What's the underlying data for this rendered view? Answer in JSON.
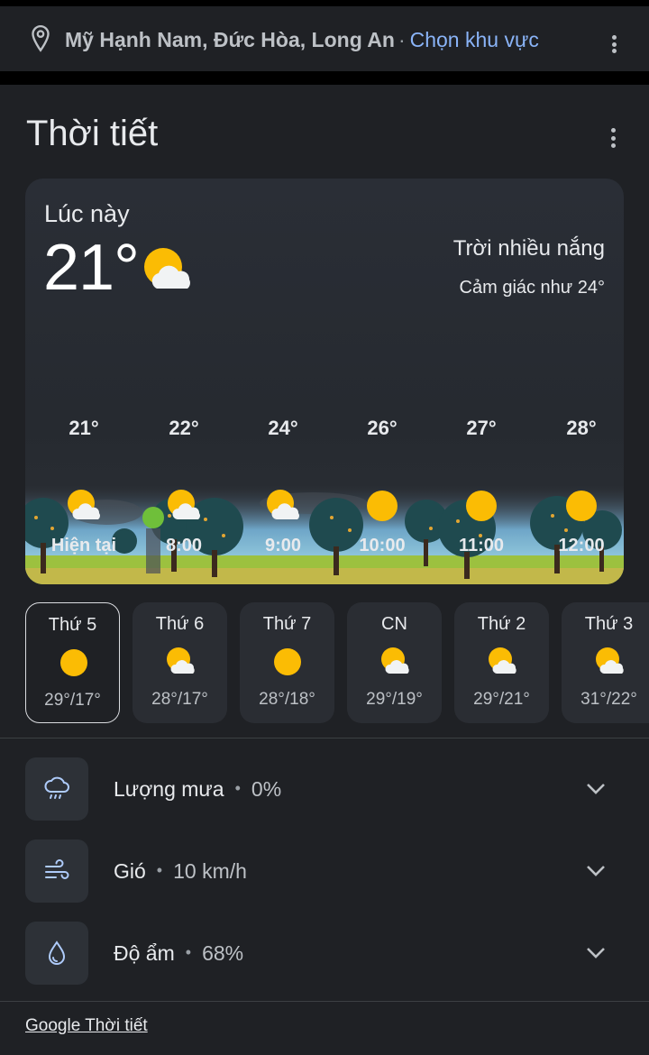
{
  "location": {
    "place": "Mỹ Hạnh Nam, Đức Hòa, Long An",
    "separator": "·",
    "change_link": "Chọn khu vực"
  },
  "card": {
    "title": "Thời tiết"
  },
  "current": {
    "label": "Lúc này",
    "temp": "21°",
    "condition": "Trời nhiều nắng",
    "feels_like": "Cảm giác như 24°",
    "icon": "partly-sunny-icon"
  },
  "hourly": [
    {
      "temp": "21°",
      "label": "Hiện tại",
      "icon": "partly-sunny-icon"
    },
    {
      "temp": "22°",
      "label": "8:00",
      "icon": "partly-sunny-icon"
    },
    {
      "temp": "24°",
      "label": "9:00",
      "icon": "partly-sunny-icon"
    },
    {
      "temp": "26°",
      "label": "10:00",
      "icon": "sunny-icon"
    },
    {
      "temp": "27°",
      "label": "11:00",
      "icon": "sunny-icon"
    },
    {
      "temp": "28°",
      "label": "12:00",
      "icon": "sunny-icon"
    }
  ],
  "daily": [
    {
      "day": "Thứ 5",
      "temps": "29°/17°",
      "icon": "sunny-icon",
      "selected": true
    },
    {
      "day": "Thứ 6",
      "temps": "28°/17°",
      "icon": "partly-sunny-icon",
      "selected": false
    },
    {
      "day": "Thứ 7",
      "temps": "28°/18°",
      "icon": "sunny-icon",
      "selected": false
    },
    {
      "day": "CN",
      "temps": "29°/19°",
      "icon": "partly-sunny-icon",
      "selected": false
    },
    {
      "day": "Thứ 2",
      "temps": "29°/21°",
      "icon": "partly-sunny-icon",
      "selected": false
    },
    {
      "day": "Thứ 3",
      "temps": "31°/22°",
      "icon": "partly-sunny-icon",
      "selected": false
    }
  ],
  "details": [
    {
      "label": "Lượng mưa",
      "value": "0%",
      "icon": "rain-icon"
    },
    {
      "label": "Gió",
      "value": "10 km/h",
      "icon": "wind-icon"
    },
    {
      "label": "Độ ẩm",
      "value": "68%",
      "icon": "humidity-icon"
    }
  ],
  "footer": {
    "link": "Google Thời tiết"
  },
  "colors": {
    "background": "#1f2125",
    "card": "#2a2d33",
    "link": "#8ab4f8",
    "sun": "#fbbc04"
  }
}
